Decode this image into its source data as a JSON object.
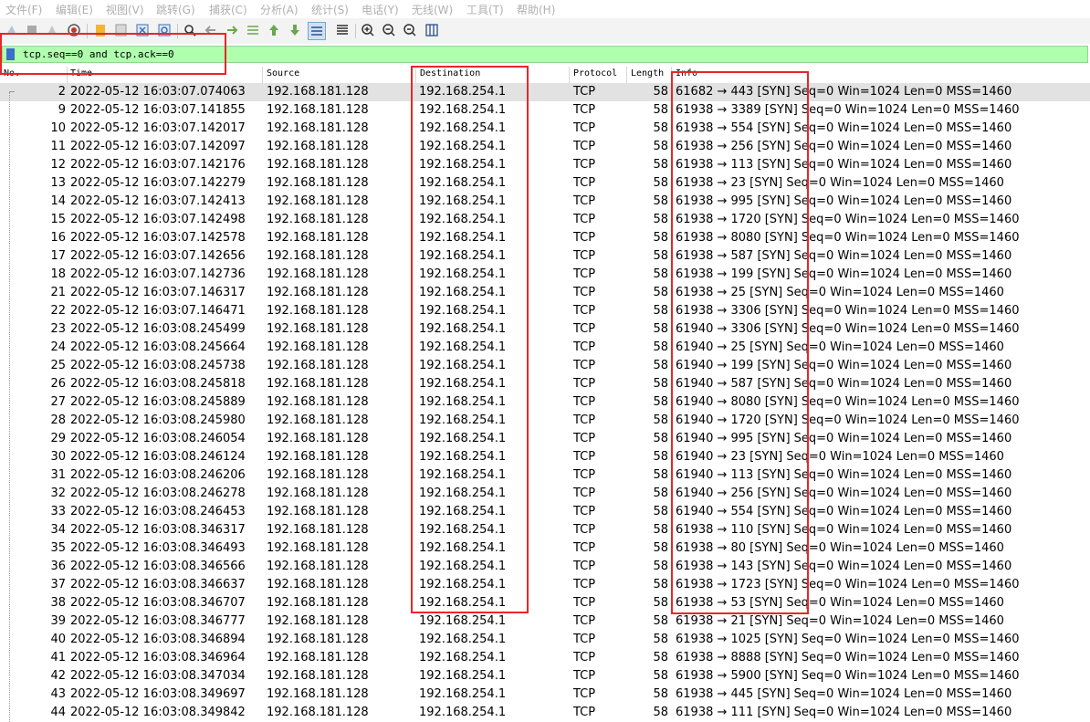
{
  "menu": [
    "文件(F)",
    "编辑(E)",
    "视图(V)",
    "跳转(G)",
    "捕获(C)",
    "分析(A)",
    "统计(S)",
    "电话(Y)",
    "无线(W)",
    "工具(T)",
    "帮助(H)"
  ],
  "toolbar": {
    "icons": [
      "shark-fin-start-icon",
      "stop-capture-icon",
      "restart-capture-icon",
      "capture-options-icon",
      "open-file-icon",
      "save-file-icon",
      "close-file-icon",
      "reload-file-icon",
      "find-packet-icon",
      "go-back-icon",
      "go-forward-icon",
      "go-to-packet-icon",
      "go-first-packet-icon",
      "go-last-packet-icon",
      "autoscroll-icon",
      "colorize-icon",
      "zoom-in-icon",
      "zoom-out-icon",
      "zoom-normal-icon",
      "resize-columns-icon"
    ]
  },
  "filter": {
    "text": "tcp.seq==0 and tcp.ack==0",
    "color": "#afffaf"
  },
  "columns": {
    "no": "No.",
    "time": "Time",
    "source": "Source",
    "destination": "Destination",
    "protocol": "Protocol",
    "length": "Length",
    "info": "Info"
  },
  "packets": [
    {
      "no": "2",
      "time": "2022-05-12 16:03:07.074063",
      "src": "192.168.181.128",
      "dst": "192.168.254.1",
      "proto": "TCP",
      "len": "58",
      "info": "61682 → 443 [SYN] Seq=0 Win=1024 Len=0 MSS=1460"
    },
    {
      "no": "9",
      "time": "2022-05-12 16:03:07.141855",
      "src": "192.168.181.128",
      "dst": "192.168.254.1",
      "proto": "TCP",
      "len": "58",
      "info": "61938 → 3389 [SYN] Seq=0 Win=1024 Len=0 MSS=1460"
    },
    {
      "no": "10",
      "time": "2022-05-12 16:03:07.142017",
      "src": "192.168.181.128",
      "dst": "192.168.254.1",
      "proto": "TCP",
      "len": "58",
      "info": "61938 → 554 [SYN] Seq=0 Win=1024 Len=0 MSS=1460"
    },
    {
      "no": "11",
      "time": "2022-05-12 16:03:07.142097",
      "src": "192.168.181.128",
      "dst": "192.168.254.1",
      "proto": "TCP",
      "len": "58",
      "info": "61938 → 256 [SYN] Seq=0 Win=1024 Len=0 MSS=1460"
    },
    {
      "no": "12",
      "time": "2022-05-12 16:03:07.142176",
      "src": "192.168.181.128",
      "dst": "192.168.254.1",
      "proto": "TCP",
      "len": "58",
      "info": "61938 → 113 [SYN] Seq=0 Win=1024 Len=0 MSS=1460"
    },
    {
      "no": "13",
      "time": "2022-05-12 16:03:07.142279",
      "src": "192.168.181.128",
      "dst": "192.168.254.1",
      "proto": "TCP",
      "len": "58",
      "info": "61938 → 23 [SYN] Seq=0 Win=1024 Len=0 MSS=1460"
    },
    {
      "no": "14",
      "time": "2022-05-12 16:03:07.142413",
      "src": "192.168.181.128",
      "dst": "192.168.254.1",
      "proto": "TCP",
      "len": "58",
      "info": "61938 → 995 [SYN] Seq=0 Win=1024 Len=0 MSS=1460"
    },
    {
      "no": "15",
      "time": "2022-05-12 16:03:07.142498",
      "src": "192.168.181.128",
      "dst": "192.168.254.1",
      "proto": "TCP",
      "len": "58",
      "info": "61938 → 1720 [SYN] Seq=0 Win=1024 Len=0 MSS=1460"
    },
    {
      "no": "16",
      "time": "2022-05-12 16:03:07.142578",
      "src": "192.168.181.128",
      "dst": "192.168.254.1",
      "proto": "TCP",
      "len": "58",
      "info": "61938 → 8080 [SYN] Seq=0 Win=1024 Len=0 MSS=1460"
    },
    {
      "no": "17",
      "time": "2022-05-12 16:03:07.142656",
      "src": "192.168.181.128",
      "dst": "192.168.254.1",
      "proto": "TCP",
      "len": "58",
      "info": "61938 → 587 [SYN] Seq=0 Win=1024 Len=0 MSS=1460"
    },
    {
      "no": "18",
      "time": "2022-05-12 16:03:07.142736",
      "src": "192.168.181.128",
      "dst": "192.168.254.1",
      "proto": "TCP",
      "len": "58",
      "info": "61938 → 199 [SYN] Seq=0 Win=1024 Len=0 MSS=1460"
    },
    {
      "no": "21",
      "time": "2022-05-12 16:03:07.146317",
      "src": "192.168.181.128",
      "dst": "192.168.254.1",
      "proto": "TCP",
      "len": "58",
      "info": "61938 → 25 [SYN] Seq=0 Win=1024 Len=0 MSS=1460"
    },
    {
      "no": "22",
      "time": "2022-05-12 16:03:07.146471",
      "src": "192.168.181.128",
      "dst": "192.168.254.1",
      "proto": "TCP",
      "len": "58",
      "info": "61938 → 3306 [SYN] Seq=0 Win=1024 Len=0 MSS=1460"
    },
    {
      "no": "23",
      "time": "2022-05-12 16:03:08.245499",
      "src": "192.168.181.128",
      "dst": "192.168.254.1",
      "proto": "TCP",
      "len": "58",
      "info": "61940 → 3306 [SYN] Seq=0 Win=1024 Len=0 MSS=1460"
    },
    {
      "no": "24",
      "time": "2022-05-12 16:03:08.245664",
      "src": "192.168.181.128",
      "dst": "192.168.254.1",
      "proto": "TCP",
      "len": "58",
      "info": "61940 → 25 [SYN] Seq=0 Win=1024 Len=0 MSS=1460"
    },
    {
      "no": "25",
      "time": "2022-05-12 16:03:08.245738",
      "src": "192.168.181.128",
      "dst": "192.168.254.1",
      "proto": "TCP",
      "len": "58",
      "info": "61940 → 199 [SYN] Seq=0 Win=1024 Len=0 MSS=1460"
    },
    {
      "no": "26",
      "time": "2022-05-12 16:03:08.245818",
      "src": "192.168.181.128",
      "dst": "192.168.254.1",
      "proto": "TCP",
      "len": "58",
      "info": "61940 → 587 [SYN] Seq=0 Win=1024 Len=0 MSS=1460"
    },
    {
      "no": "27",
      "time": "2022-05-12 16:03:08.245889",
      "src": "192.168.181.128",
      "dst": "192.168.254.1",
      "proto": "TCP",
      "len": "58",
      "info": "61940 → 8080 [SYN] Seq=0 Win=1024 Len=0 MSS=1460"
    },
    {
      "no": "28",
      "time": "2022-05-12 16:03:08.245980",
      "src": "192.168.181.128",
      "dst": "192.168.254.1",
      "proto": "TCP",
      "len": "58",
      "info": "61940 → 1720 [SYN] Seq=0 Win=1024 Len=0 MSS=1460"
    },
    {
      "no": "29",
      "time": "2022-05-12 16:03:08.246054",
      "src": "192.168.181.128",
      "dst": "192.168.254.1",
      "proto": "TCP",
      "len": "58",
      "info": "61940 → 995 [SYN] Seq=0 Win=1024 Len=0 MSS=1460"
    },
    {
      "no": "30",
      "time": "2022-05-12 16:03:08.246124",
      "src": "192.168.181.128",
      "dst": "192.168.254.1",
      "proto": "TCP",
      "len": "58",
      "info": "61940 → 23 [SYN] Seq=0 Win=1024 Len=0 MSS=1460"
    },
    {
      "no": "31",
      "time": "2022-05-12 16:03:08.246206",
      "src": "192.168.181.128",
      "dst": "192.168.254.1",
      "proto": "TCP",
      "len": "58",
      "info": "61940 → 113 [SYN] Seq=0 Win=1024 Len=0 MSS=1460"
    },
    {
      "no": "32",
      "time": "2022-05-12 16:03:08.246278",
      "src": "192.168.181.128",
      "dst": "192.168.254.1",
      "proto": "TCP",
      "len": "58",
      "info": "61940 → 256 [SYN] Seq=0 Win=1024 Len=0 MSS=1460"
    },
    {
      "no": "33",
      "time": "2022-05-12 16:03:08.246453",
      "src": "192.168.181.128",
      "dst": "192.168.254.1",
      "proto": "TCP",
      "len": "58",
      "info": "61940 → 554 [SYN] Seq=0 Win=1024 Len=0 MSS=1460"
    },
    {
      "no": "34",
      "time": "2022-05-12 16:03:08.346317",
      "src": "192.168.181.128",
      "dst": "192.168.254.1",
      "proto": "TCP",
      "len": "58",
      "info": "61938 → 110 [SYN] Seq=0 Win=1024 Len=0 MSS=1460"
    },
    {
      "no": "35",
      "time": "2022-05-12 16:03:08.346493",
      "src": "192.168.181.128",
      "dst": "192.168.254.1",
      "proto": "TCP",
      "len": "58",
      "info": "61938 → 80 [SYN] Seq=0 Win=1024 Len=0 MSS=1460"
    },
    {
      "no": "36",
      "time": "2022-05-12 16:03:08.346566",
      "src": "192.168.181.128",
      "dst": "192.168.254.1",
      "proto": "TCP",
      "len": "58",
      "info": "61938 → 143 [SYN] Seq=0 Win=1024 Len=0 MSS=1460"
    },
    {
      "no": "37",
      "time": "2022-05-12 16:03:08.346637",
      "src": "192.168.181.128",
      "dst": "192.168.254.1",
      "proto": "TCP",
      "len": "58",
      "info": "61938 → 1723 [SYN] Seq=0 Win=1024 Len=0 MSS=1460"
    },
    {
      "no": "38",
      "time": "2022-05-12 16:03:08.346707",
      "src": "192.168.181.128",
      "dst": "192.168.254.1",
      "proto": "TCP",
      "len": "58",
      "info": "61938 → 53 [SYN] Seq=0 Win=1024 Len=0 MSS=1460"
    },
    {
      "no": "39",
      "time": "2022-05-12 16:03:08.346777",
      "src": "192.168.181.128",
      "dst": "192.168.254.1",
      "proto": "TCP",
      "len": "58",
      "info": "61938 → 21 [SYN] Seq=0 Win=1024 Len=0 MSS=1460"
    },
    {
      "no": "40",
      "time": "2022-05-12 16:03:08.346894",
      "src": "192.168.181.128",
      "dst": "192.168.254.1",
      "proto": "TCP",
      "len": "58",
      "info": "61938 → 1025 [SYN] Seq=0 Win=1024 Len=0 MSS=1460"
    },
    {
      "no": "41",
      "time": "2022-05-12 16:03:08.346964",
      "src": "192.168.181.128",
      "dst": "192.168.254.1",
      "proto": "TCP",
      "len": "58",
      "info": "61938 → 8888 [SYN] Seq=0 Win=1024 Len=0 MSS=1460"
    },
    {
      "no": "42",
      "time": "2022-05-12 16:03:08.347034",
      "src": "192.168.181.128",
      "dst": "192.168.254.1",
      "proto": "TCP",
      "len": "58",
      "info": "61938 → 5900 [SYN] Seq=0 Win=1024 Len=0 MSS=1460"
    },
    {
      "no": "43",
      "time": "2022-05-12 16:03:08.349697",
      "src": "192.168.181.128",
      "dst": "192.168.254.1",
      "proto": "TCP",
      "len": "58",
      "info": "61938 → 445 [SYN] Seq=0 Win=1024 Len=0 MSS=1460"
    },
    {
      "no": "44",
      "time": "2022-05-12 16:03:08.349842",
      "src": "192.168.181.128",
      "dst": "192.168.254.1",
      "proto": "TCP",
      "len": "58",
      "info": "61938 → 111 [SYN] Seq=0 Win=1024 Len=0 MSS=1460"
    }
  ],
  "colors": {
    "annotation": "#e8262a",
    "selected_row": "#e2e2e2",
    "filter_bg": "#afffaf"
  }
}
